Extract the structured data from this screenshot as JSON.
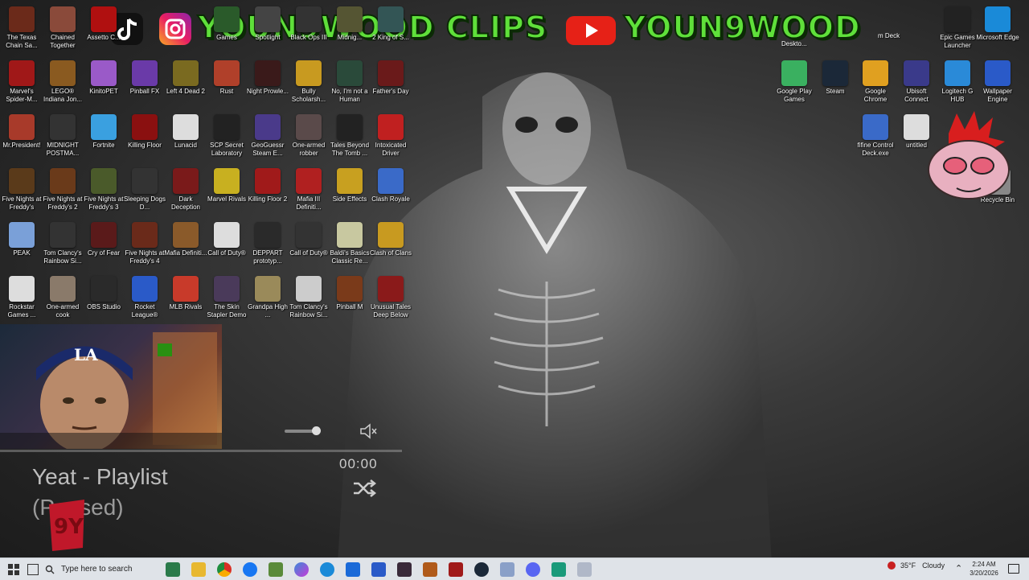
{
  "banner": {
    "left_text": "YOUN9WOOD CLIPS",
    "right_text": "YOUN9WOOD"
  },
  "desktop_icons": [
    {
      "label": "The Texas Chain Sa...",
      "color": "#6b2a1a"
    },
    {
      "label": "Chained Together",
      "color": "#8a4a3a"
    },
    {
      "label": "Assetto C...",
      "color": "#b01010"
    },
    {
      "label": "Games",
      "color": "#2a5a2a"
    },
    {
      "label": "Spotlight",
      "color": "#444"
    },
    {
      "label": "Black Ops III",
      "color": "#333"
    },
    {
      "label": "Midnig...",
      "color": "#553"
    },
    {
      "label": "2 King of S...",
      "color": "#355"
    },
    {
      "label": "Marvel's Spider-M...",
      "color": "#a01818"
    },
    {
      "label": "LEGO® Indiana Jon...",
      "color": "#8a5a20"
    },
    {
      "label": "KinitoPET",
      "color": "#9a5ac8"
    },
    {
      "label": "Pinball FX",
      "color": "#6a3aa8"
    },
    {
      "label": "Left 4 Dead 2",
      "color": "#7a6a20"
    },
    {
      "label": "Rust",
      "color": "#b0402a"
    },
    {
      "label": "Night Prowle...",
      "color": "#3a1a1a"
    },
    {
      "label": "Bully Scholarsh...",
      "color": "#c89a20"
    },
    {
      "label": "No, I'm not a Human",
      "color": "#2a4a3a"
    },
    {
      "label": "Father's Day",
      "color": "#6a1a1a"
    },
    {
      "label": "Mr.President!",
      "color": "#a83a2a"
    },
    {
      "label": "MIDNIGHT POSTMA...",
      "color": "#333"
    },
    {
      "label": "Fortnite",
      "color": "#3aa0e0"
    },
    {
      "label": "Killing Floor",
      "color": "#8a1010"
    },
    {
      "label": "Lunacid",
      "color": "#ddd"
    },
    {
      "label": "SCP Secret Laboratory",
      "color": "#222"
    },
    {
      "label": "GeoGuessr Steam E...",
      "color": "#4a3a8a"
    },
    {
      "label": "One-armed robber",
      "color": "#5a4a4a"
    },
    {
      "label": "Tales Beyond The Tomb ...",
      "color": "#222"
    },
    {
      "label": "Intoxicated Driver",
      "color": "#c02020"
    },
    {
      "label": "Five Nights at Freddy's",
      "color": "#5a3a1a"
    },
    {
      "label": "Five Nights at Freddy's 2",
      "color": "#6a3a1a"
    },
    {
      "label": "Five Nights at Freddy's 3",
      "color": "#4a5a2a"
    },
    {
      "label": "Sleeping Dogs D...",
      "color": "#333"
    },
    {
      "label": "Dark Deception",
      "color": "#7a1a1a"
    },
    {
      "label": "Marvel Rivals",
      "color": "#c8b020"
    },
    {
      "label": "Killing Floor 2",
      "color": "#a01a1a"
    },
    {
      "label": "Mafia III Definiti...",
      "color": "#b02020"
    },
    {
      "label": "Side Effects",
      "color": "#c8a020"
    },
    {
      "label": "Clash Royale",
      "color": "#3a6ac8"
    },
    {
      "label": "PEAK",
      "color": "#7aa0d8"
    },
    {
      "label": "Tom Clancy's Rainbow Si...",
      "color": "#333"
    },
    {
      "label": "Cry of Fear",
      "color": "#5a1a1a"
    },
    {
      "label": "Five Nights at Freddy's 4",
      "color": "#6a2a1a"
    },
    {
      "label": "Mafia Definiti...",
      "color": "#8a5a2a"
    },
    {
      "label": "Call of Duty®",
      "color": "#ddd"
    },
    {
      "label": "DEPPART prototyp...",
      "color": "#2a2a2a"
    },
    {
      "label": "Call of Duty®",
      "color": "#333"
    },
    {
      "label": "Baldi's Basics Classic Re...",
      "color": "#c8c8a0"
    },
    {
      "label": "Clash of Clans",
      "color": "#c89a20"
    },
    {
      "label": "Rockstar Games ...",
      "color": "#ddd"
    },
    {
      "label": "One-armed cook",
      "color": "#8a7a6a"
    },
    {
      "label": "OBS Studio",
      "color": "#2a2a2a"
    },
    {
      "label": "Rocket League®",
      "color": "#2a5ac8"
    },
    {
      "label": "MLB Rivals",
      "color": "#c83a2a"
    },
    {
      "label": "The Skin Stapler Demo",
      "color": "#4a3a5a"
    },
    {
      "label": "Grandpa High ...",
      "color": "#9a8a5a"
    },
    {
      "label": "Tom Clancy's Rainbow Si...",
      "color": "#ccc"
    },
    {
      "label": "Pinball M",
      "color": "#7a3a1a"
    },
    {
      "label": "Unusual Tales Deep Below",
      "color": "#8a1a1a"
    }
  ],
  "right_icons": [
    {
      "label": "Epic Games Launcher",
      "color": "#222"
    },
    {
      "label": "Microsoft Edge",
      "color": "#1a8ad8"
    },
    {
      "label": "Google Play Games",
      "color": "#3ab060"
    },
    {
      "label": "Steam",
      "color": "#1b2838"
    },
    {
      "label": "Google Chrome",
      "color": "#e0a020"
    },
    {
      "label": "Ubisoft Connect",
      "color": "#3a3a8a"
    },
    {
      "label": "Logitech G HUB",
      "color": "#2a8ad8"
    },
    {
      "label": "Wallpaper Engine",
      "color": "#2a5ac8"
    },
    {
      "label": "fifine Control Deck.exe",
      "color": "#3a6ac8"
    },
    {
      "label": "untitled",
      "color": "#ddd"
    },
    {
      "label": "Recycle Bin",
      "color": "#888"
    }
  ],
  "top_partial": {
    "m_deck": "m Deck",
    "desktop": "Deskto..."
  },
  "player": {
    "title": "Yeat - Playlist",
    "status": "(Paused)",
    "time": "00:00"
  },
  "taskbar": {
    "search_placeholder": "Type here to search",
    "weather_temp": "35°F",
    "weather_desc": "Cloudy",
    "time": "2:24 AM",
    "date": "3/20/2026"
  }
}
